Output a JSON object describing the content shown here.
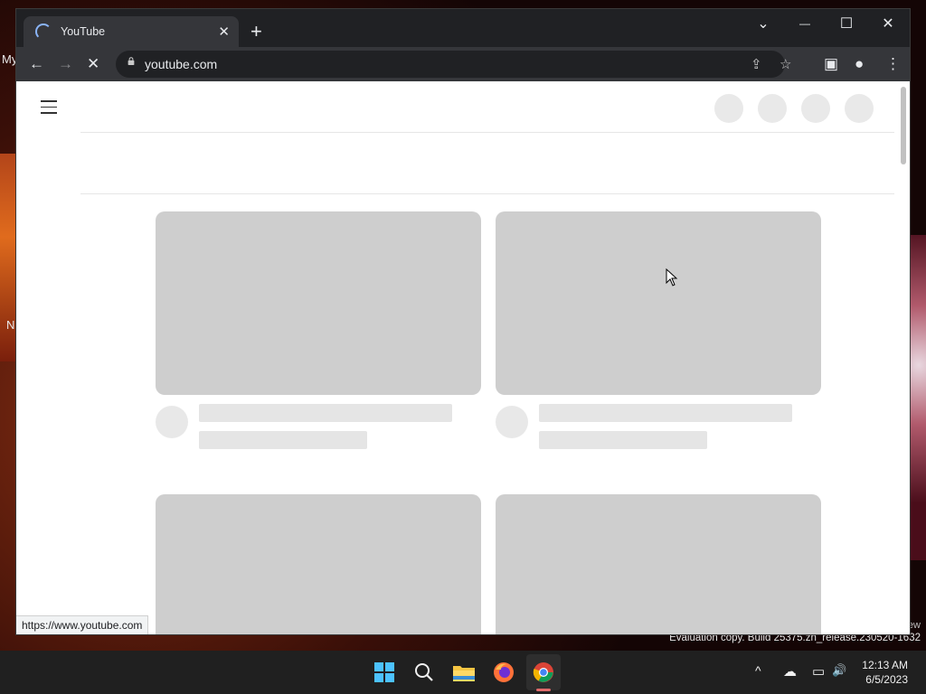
{
  "desktop": {
    "top_left_text": "My",
    "left_edge_text": "N",
    "eval_top": "ew",
    "eval_text": "Evaluation copy. Build 25375.zn_release.230520-1632"
  },
  "browser": {
    "tab_title": "YouTube",
    "tab_close": "✕",
    "new_tab": "+",
    "window_controls": {
      "tab_search": "⌄",
      "minimize": "—",
      "maximize": "☐",
      "close": "✕"
    },
    "nav": {
      "back": "←",
      "forward": "→",
      "stop": "✕"
    },
    "address": "youtube.com",
    "omnibox_icons": {
      "share": "⇪",
      "bookmark": "☆"
    },
    "toolbar_icons": {
      "side_panel": "▣",
      "profile": "●",
      "menu": "⋮"
    },
    "status_url": "https://www.youtube.com"
  },
  "taskbar": {
    "time": "12:13 AM",
    "date": "6/5/2023",
    "tray": {
      "chevron": "^",
      "network": "☁",
      "display": "▭",
      "volume": "🔊"
    }
  },
  "colors": {
    "chrome_dark": "#202124",
    "chrome_toolbar": "#35363a",
    "skeleton": "#cecece",
    "accent_spinner": "#8ab4f8"
  }
}
